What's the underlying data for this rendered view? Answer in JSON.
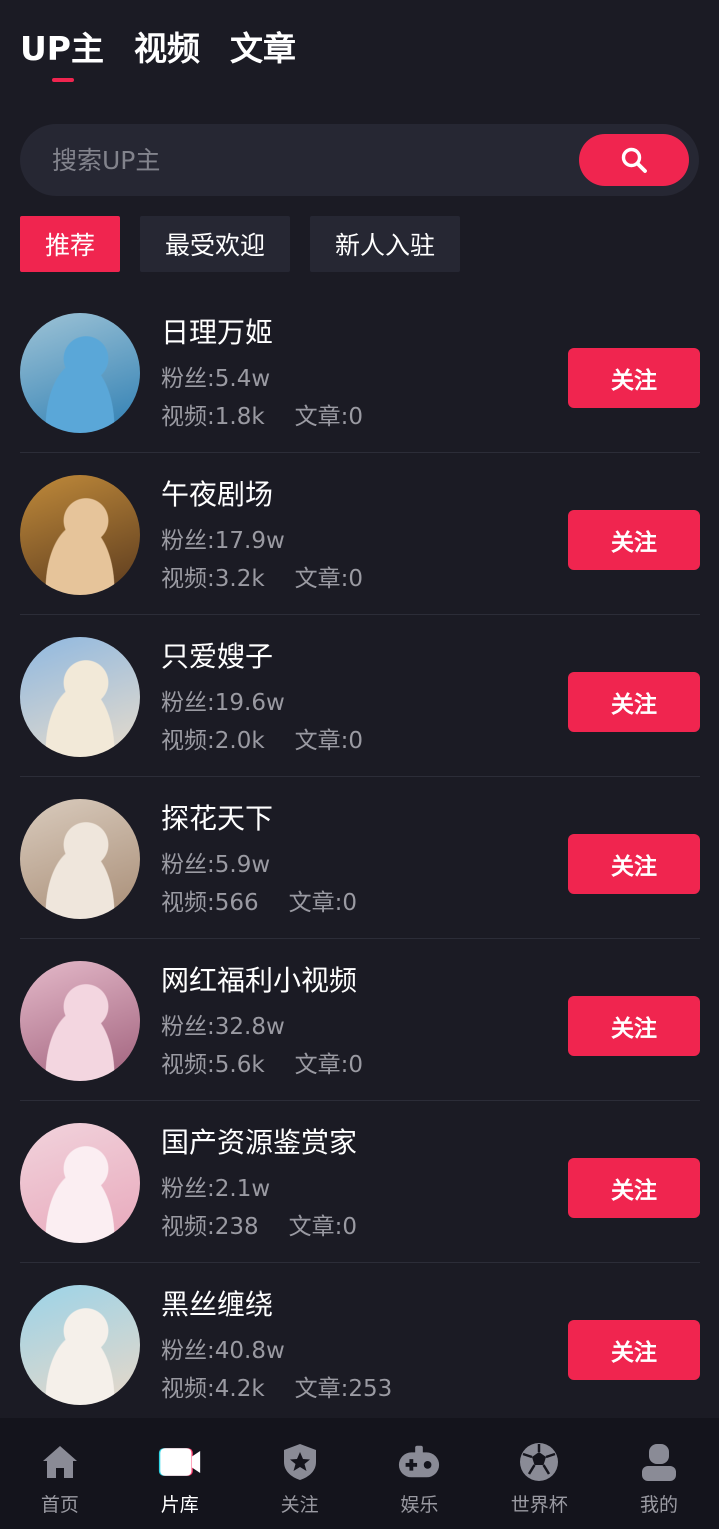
{
  "top_tabs": [
    {
      "label": "UP主",
      "active": true
    },
    {
      "label": "视频",
      "active": false
    },
    {
      "label": "文章",
      "active": false
    }
  ],
  "search": {
    "placeholder": "搜索UP主",
    "icon": "search-icon"
  },
  "filters": [
    {
      "label": "推荐",
      "active": true
    },
    {
      "label": "最受欢迎",
      "active": false
    },
    {
      "label": "新人入驻",
      "active": false
    }
  ],
  "up_list": [
    {
      "name": "日理万姬",
      "fans": "粉丝:5.4w",
      "videos": "视频:1.8k",
      "articles": "文章:0",
      "follow_label": "关注",
      "avatar_colors": [
        "#9ec3d6",
        "#2f7fb3",
        "#5aa7d8"
      ]
    },
    {
      "name": "午夜剧场",
      "fans": "粉丝:17.9w",
      "videos": "视频:3.2k",
      "articles": "文章:0",
      "follow_label": "关注",
      "avatar_colors": [
        "#c08a3a",
        "#5a3a1e",
        "#e6c49a"
      ]
    },
    {
      "name": "只爱嫂子",
      "fans": "粉丝:19.6w",
      "videos": "视频:2.0k",
      "articles": "文章:0",
      "follow_label": "关注",
      "avatar_colors": [
        "#8fb8e0",
        "#e8dccb",
        "#f2e9d8"
      ]
    },
    {
      "name": "探花天下",
      "fans": "粉丝:5.9w",
      "videos": "视频:566",
      "articles": "文章:0",
      "follow_label": "关注",
      "avatar_colors": [
        "#d9cbbd",
        "#a88d76",
        "#efe6dc"
      ]
    },
    {
      "name": "网红福利小视频",
      "fans": "粉丝:32.8w",
      "videos": "视频:5.6k",
      "articles": "文章:0",
      "follow_label": "关注",
      "avatar_colors": [
        "#e4b9c9",
        "#a0617c",
        "#f3d6e0"
      ]
    },
    {
      "name": "国产资源鉴赏家",
      "fans": "粉丝:2.1w",
      "videos": "视频:238",
      "articles": "文章:0",
      "follow_label": "关注",
      "avatar_colors": [
        "#f1d3dc",
        "#e8a8bb",
        "#fbeef2"
      ]
    },
    {
      "name": "黑丝缠绕",
      "fans": "粉丝:40.8w",
      "videos": "视频:4.2k",
      "articles": "文章:253",
      "follow_label": "关注",
      "avatar_colors": [
        "#9bd3e8",
        "#e8d8c8",
        "#f5f0ea"
      ]
    }
  ],
  "bottom_nav": [
    {
      "label": "首页",
      "icon": "home-icon",
      "active": false
    },
    {
      "label": "片库",
      "icon": "video-camera-icon",
      "active": true
    },
    {
      "label": "关注",
      "icon": "shield-star-icon",
      "active": false
    },
    {
      "label": "娱乐",
      "icon": "gamepad-icon",
      "active": false
    },
    {
      "label": "世界杯",
      "icon": "soccer-ball-icon",
      "active": false
    },
    {
      "label": "我的",
      "icon": "user-icon",
      "active": false
    }
  ],
  "colors": {
    "accent": "#f0254f",
    "background": "#1b1b24",
    "surface": "#262733",
    "muted_text": "#9a9aa2"
  }
}
